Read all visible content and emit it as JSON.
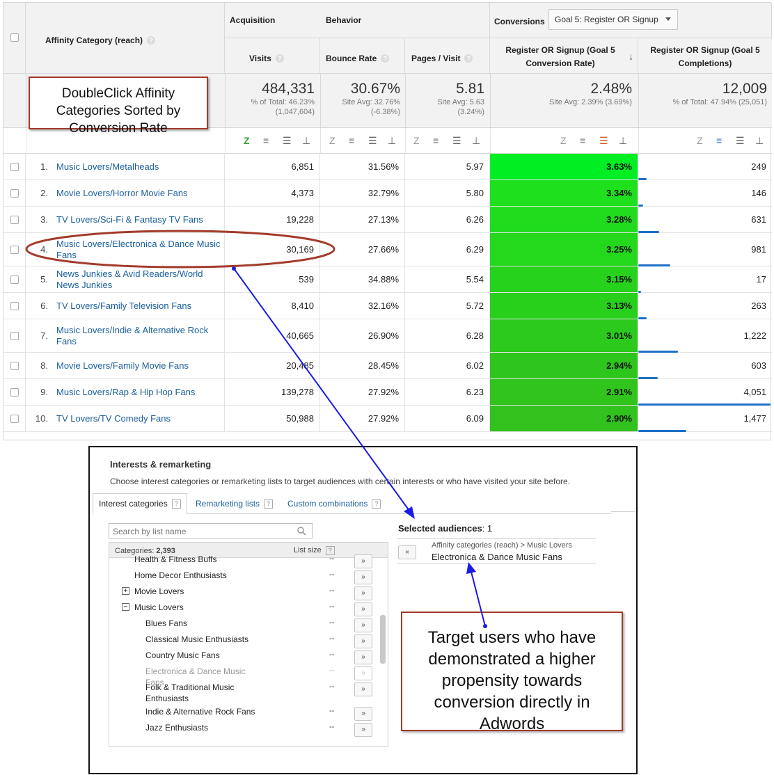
{
  "report": {
    "dimension_header": "Affinity Category (reach)",
    "group_headers": {
      "acquisition": "Acquisition",
      "behavior": "Behavior",
      "conversions": "Conversions"
    },
    "goal_select": "Goal 5: Register OR Signup",
    "columns": {
      "visits": "Visits",
      "bounce": "Bounce Rate",
      "pages": "Pages / Visit",
      "conv_rate": "Register OR Signup (Goal 5 Conversion Rate)",
      "completions": "Register OR Signup (Goal 5 Completions)"
    },
    "totals": {
      "visits": "484,331",
      "visits_sub1": "% of Total: 46.23%",
      "visits_sub2": "(1,047,604)",
      "bounce": "30.67%",
      "bounce_sub1": "Site Avg: 32.76%",
      "bounce_sub2": "(-6.38%)",
      "pages": "5.81",
      "pages_sub1": "Site Avg: 5.63",
      "pages_sub2": "(3.24%)",
      "conv": "2.48%",
      "conv_sub1": "Site Avg: 2.39% (3.69%)",
      "completions": "12,009",
      "completions_sub1": "% of Total: 47.94% (25,051)"
    },
    "rows": [
      {
        "idx": "1.",
        "category": "Music Lovers/Metalheads",
        "visits": "6,851",
        "bounce": "31.56%",
        "pages": "5.97",
        "conv": "3.63%",
        "completions": "249",
        "completions_value": 249,
        "conv_color": "#00ee22"
      },
      {
        "idx": "2.",
        "category": "Movie Lovers/Horror Movie Fans",
        "visits": "4,373",
        "bounce": "32.79%",
        "pages": "5.80",
        "conv": "3.34%",
        "completions": "146",
        "completions_value": 146,
        "conv_color": "#1ee01c"
      },
      {
        "idx": "3.",
        "category": "TV Lovers/Sci-Fi & Fantasy TV Fans",
        "visits": "19,228",
        "bounce": "27.13%",
        "pages": "6.26",
        "conv": "3.28%",
        "completions": "631",
        "completions_value": 631,
        "conv_color": "#21dc1c"
      },
      {
        "idx": "4.",
        "category": "Music Lovers/Electronica & Dance Music Fans",
        "visits": "30,169",
        "bounce": "27.66%",
        "pages": "6.29",
        "conv": "3.25%",
        "completions": "981",
        "completions_value": 981,
        "conv_color": "#24d81c"
      },
      {
        "idx": "5.",
        "category": "News Junkies & Avid Readers/World News Junkies",
        "visits": "539",
        "bounce": "34.88%",
        "pages": "5.54",
        "conv": "3.15%",
        "completions": "17",
        "completions_value": 17,
        "conv_color": "#27d21c"
      },
      {
        "idx": "6.",
        "category": "TV Lovers/Family Television Fans",
        "visits": "8,410",
        "bounce": "32.16%",
        "pages": "5.72",
        "conv": "3.13%",
        "completions": "263",
        "completions_value": 263,
        "conv_color": "#28d01c"
      },
      {
        "idx": "7.",
        "category": "Music Lovers/Indie & Alternative Rock Fans",
        "visits": "40,665",
        "bounce": "26.90%",
        "pages": "6.28",
        "conv": "3.01%",
        "completions": "1,222",
        "completions_value": 1222,
        "conv_color": "#2cca1d"
      },
      {
        "idx": "8.",
        "category": "Movie Lovers/Family Movie Fans",
        "visits": "20,485",
        "bounce": "28.45%",
        "pages": "6.02",
        "conv": "2.94%",
        "completions": "603",
        "completions_value": 603,
        "conv_color": "#2ec61d"
      },
      {
        "idx": "9.",
        "category": "Music Lovers/Rap & Hip Hop Fans",
        "visits": "139,278",
        "bounce": "27.92%",
        "pages": "6.23",
        "conv": "2.91%",
        "completions": "4,051",
        "completions_value": 4051,
        "conv_color": "#30c41d"
      },
      {
        "idx": "10.",
        "category": "TV Lovers/TV Comedy Fans",
        "visits": "50,988",
        "bounce": "27.92%",
        "pages": "6.09",
        "conv": "2.90%",
        "completions": "1,477",
        "completions_value": 1477,
        "conv_color": "#31c21d"
      }
    ]
  },
  "annotations": {
    "table_callout": "DoubleClick Affinity Categories Sorted by Conversion Rate",
    "adwords_callout": "Target users who have demonstrated a higher propensity towards conversion directly in Adwords",
    "callout_border_color": "#a33b2a",
    "arrow_color": "#1a1ae6"
  },
  "adwords": {
    "title": "Interests & remarketing",
    "description": "Choose interest categories or remarketing lists to target audiences with certain interests or who have visited your site before.",
    "tabs": [
      "Interest categories",
      "Remarketing lists",
      "Custom combinations"
    ],
    "search_placeholder": "Search by list name",
    "categories_label": "Categories:",
    "categories_count": "2,393",
    "list_size_label": "List size",
    "items": [
      {
        "label": "Health & Fitness Buffs",
        "size": "--",
        "indent": 0,
        "state": "cut"
      },
      {
        "label": "Home Decor Enthusiasts",
        "size": "--",
        "indent": 0,
        "state": "normal"
      },
      {
        "label": "Movie Lovers",
        "size": "--",
        "indent": 0,
        "state": "collapsed"
      },
      {
        "label": "Music Lovers",
        "size": "--",
        "indent": 0,
        "state": "expanded"
      },
      {
        "label": "Blues Fans",
        "size": "--",
        "indent": 1,
        "state": "normal"
      },
      {
        "label": "Classical Music Enthusiasts",
        "size": "--",
        "indent": 1,
        "state": "normal"
      },
      {
        "label": "Country Music Fans",
        "size": "--",
        "indent": 1,
        "state": "normal"
      },
      {
        "label": "Electronica & Dance Music Fans",
        "size": "--",
        "indent": 1,
        "state": "disabled"
      },
      {
        "label": "Folk & Traditional Music Enthusiasts",
        "size": "--",
        "indent": 1,
        "state": "normal"
      },
      {
        "label": "Indie & Alternative Rock Fans",
        "size": "--",
        "indent": 1,
        "state": "normal"
      },
      {
        "label": "Jazz Enthusiasts",
        "size": "--",
        "indent": 1,
        "state": "normal"
      }
    ],
    "add_button_glyph": "»",
    "remove_button_glyph": "«",
    "selected_label": "Selected audiences",
    "selected_count": "1",
    "selected_path": "Affinity categories (reach) > Music Lovers",
    "selected_name": "Electronica & Dance Music Fans"
  }
}
